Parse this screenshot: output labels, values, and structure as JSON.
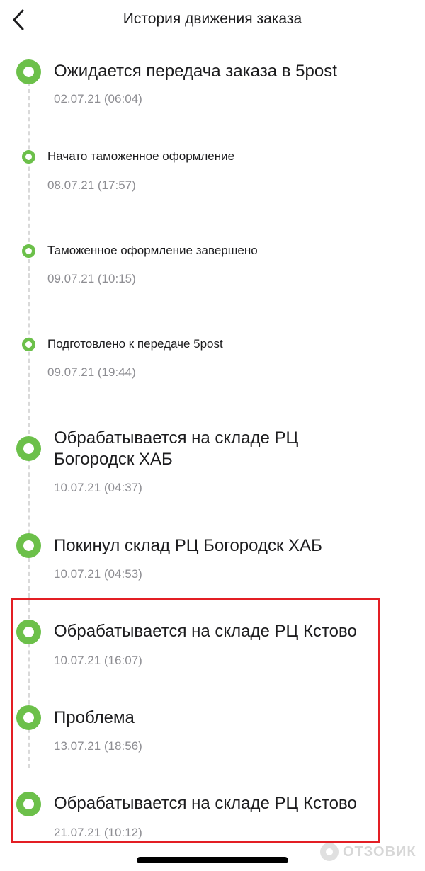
{
  "header": {
    "title": "История движения заказа",
    "back_icon": "chevron-left-icon"
  },
  "events": [
    {
      "title": "Ожидается передача заказа в 5post",
      "date": "02.07.21 (06:04)"
    },
    {
      "title": "Начато таможенное оформление",
      "date": "08.07.21 (17:57)"
    },
    {
      "title": "Таможенное оформление завершено",
      "date": "09.07.21 (10:15)"
    },
    {
      "title": "Подготовлено к передаче 5post",
      "date": "09.07.21 (19:44)"
    },
    {
      "title_line1": "Обрабатывается на складе РЦ",
      "title_line2": "Богородск ХАБ",
      "date": "10.07.21 (04:37)"
    },
    {
      "title": "Покинул склад РЦ Богородск ХАБ",
      "date": "10.07.21 (04:53)"
    },
    {
      "title": "Обрабатывается на складе РЦ Кстово",
      "date": "10.07.21 (16:07)"
    },
    {
      "title": "Проблема",
      "date": "13.07.21 (18:56)"
    },
    {
      "title": "Обрабатывается на складе РЦ Кстово",
      "date": "21.07.21 (10:12)"
    }
  ],
  "watermark": {
    "text": "ОТЗОВИК"
  },
  "colors": {
    "accent": "#6cc04a",
    "highlight": "#e31e24",
    "date": "#8e8e93"
  }
}
